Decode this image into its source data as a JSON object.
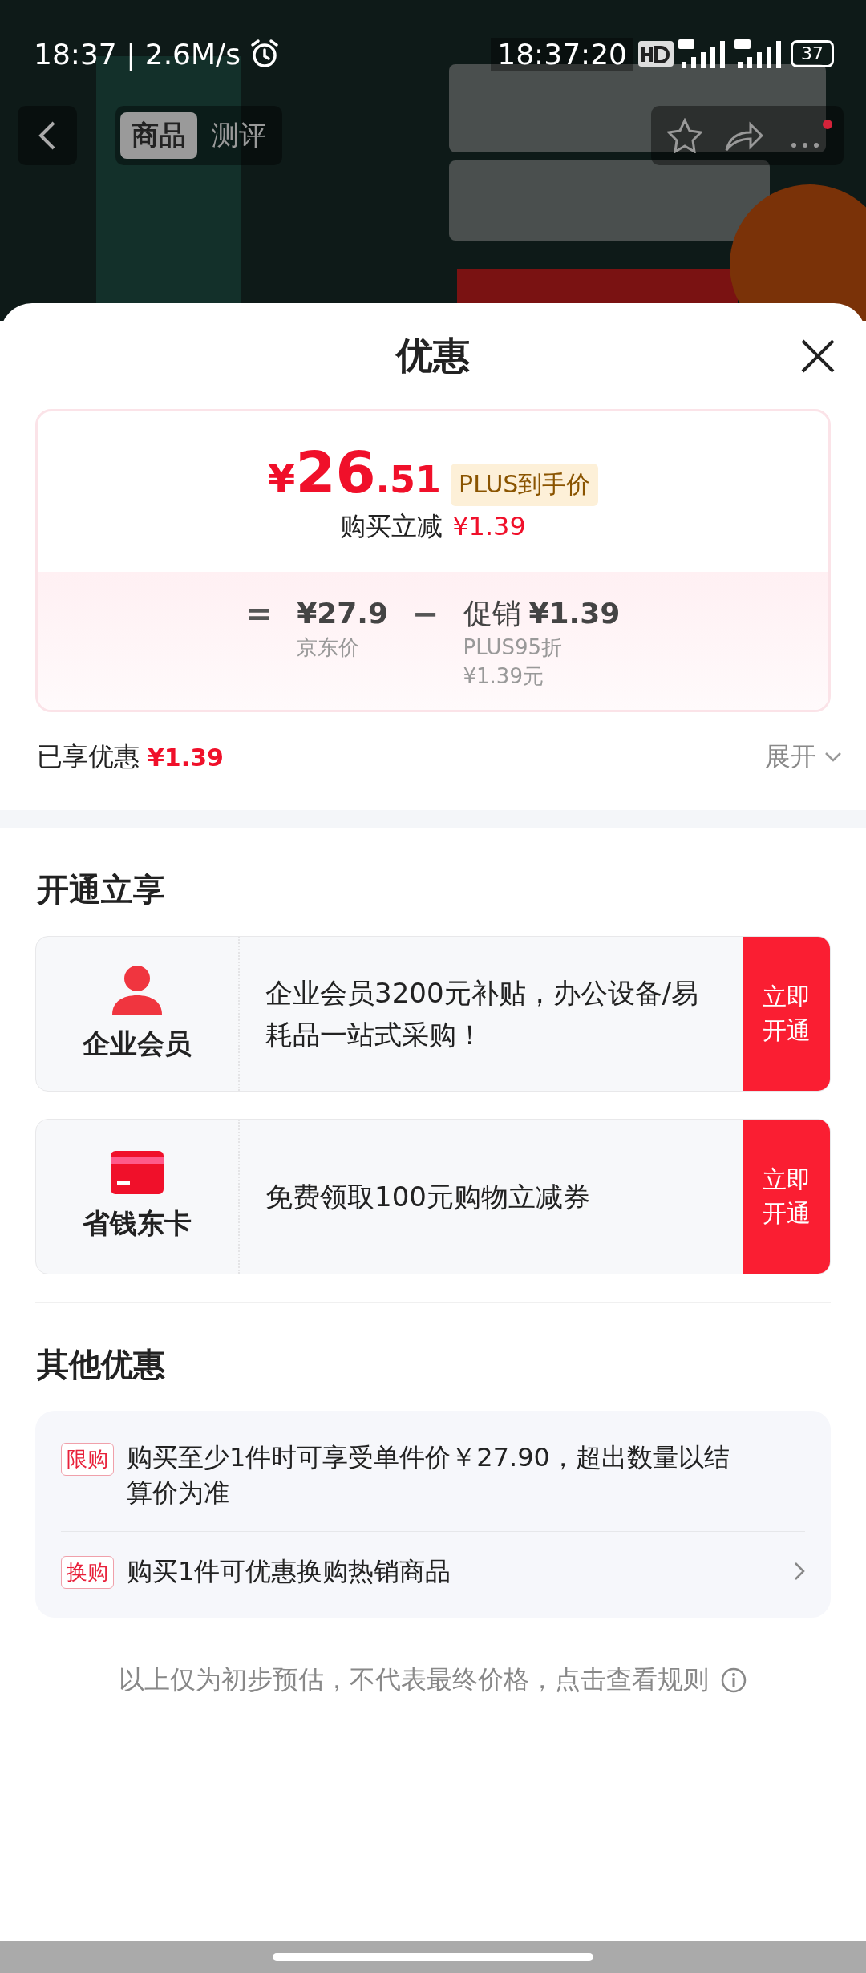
{
  "status_bar": {
    "time": "18:37 | 2.6M/s",
    "clock": "18:37:20",
    "battery": "37"
  },
  "nav": {
    "tabs": [
      {
        "label": "商品",
        "selected": true
      },
      {
        "label": "测评",
        "selected": false
      }
    ]
  },
  "sheet": {
    "title": "优惠"
  },
  "price_card": {
    "currency": "¥",
    "integer": "26",
    "decimal": ".51",
    "tag": "PLUS到手价",
    "instant_label": "购买立减",
    "instant_amount": "¥1.39",
    "breakdown": [
      {
        "kind": "operator",
        "text": "="
      },
      {
        "kind": "item",
        "amount": "¥27.9",
        "notes": [
          "京东价"
        ]
      },
      {
        "kind": "operator",
        "text": "−"
      },
      {
        "kind": "item",
        "label": "促销",
        "amount": "¥1.39",
        "notes": [
          "PLUS95折",
          "¥1.39元"
        ]
      }
    ]
  },
  "enjoyed": {
    "label": "已享优惠",
    "amount": "¥1.39",
    "toggle": "展开",
    "expanded": false
  },
  "memberships": {
    "title": "开通立享",
    "items": [
      {
        "kind": "person",
        "name": "企业会员",
        "text": "企业会员3200元补贴，办公设备/易耗品一站式采购！",
        "action": "立即开通"
      },
      {
        "kind": "card",
        "name": "省钱东卡",
        "text": "免费领取100元购物立减券",
        "action": "立即开通"
      }
    ]
  },
  "other_offers": {
    "title": "其他优惠",
    "items": [
      {
        "tag": "限购",
        "text": "购买至少1件时可享受单件价￥27.90，超出数量以结算价为准",
        "link": false
      },
      {
        "tag": "换购",
        "text": "购买1件可优惠换购热销商品",
        "link": true
      }
    ]
  },
  "note": "以上仅为初步预估，不代表最终价格，点击查看规则"
}
